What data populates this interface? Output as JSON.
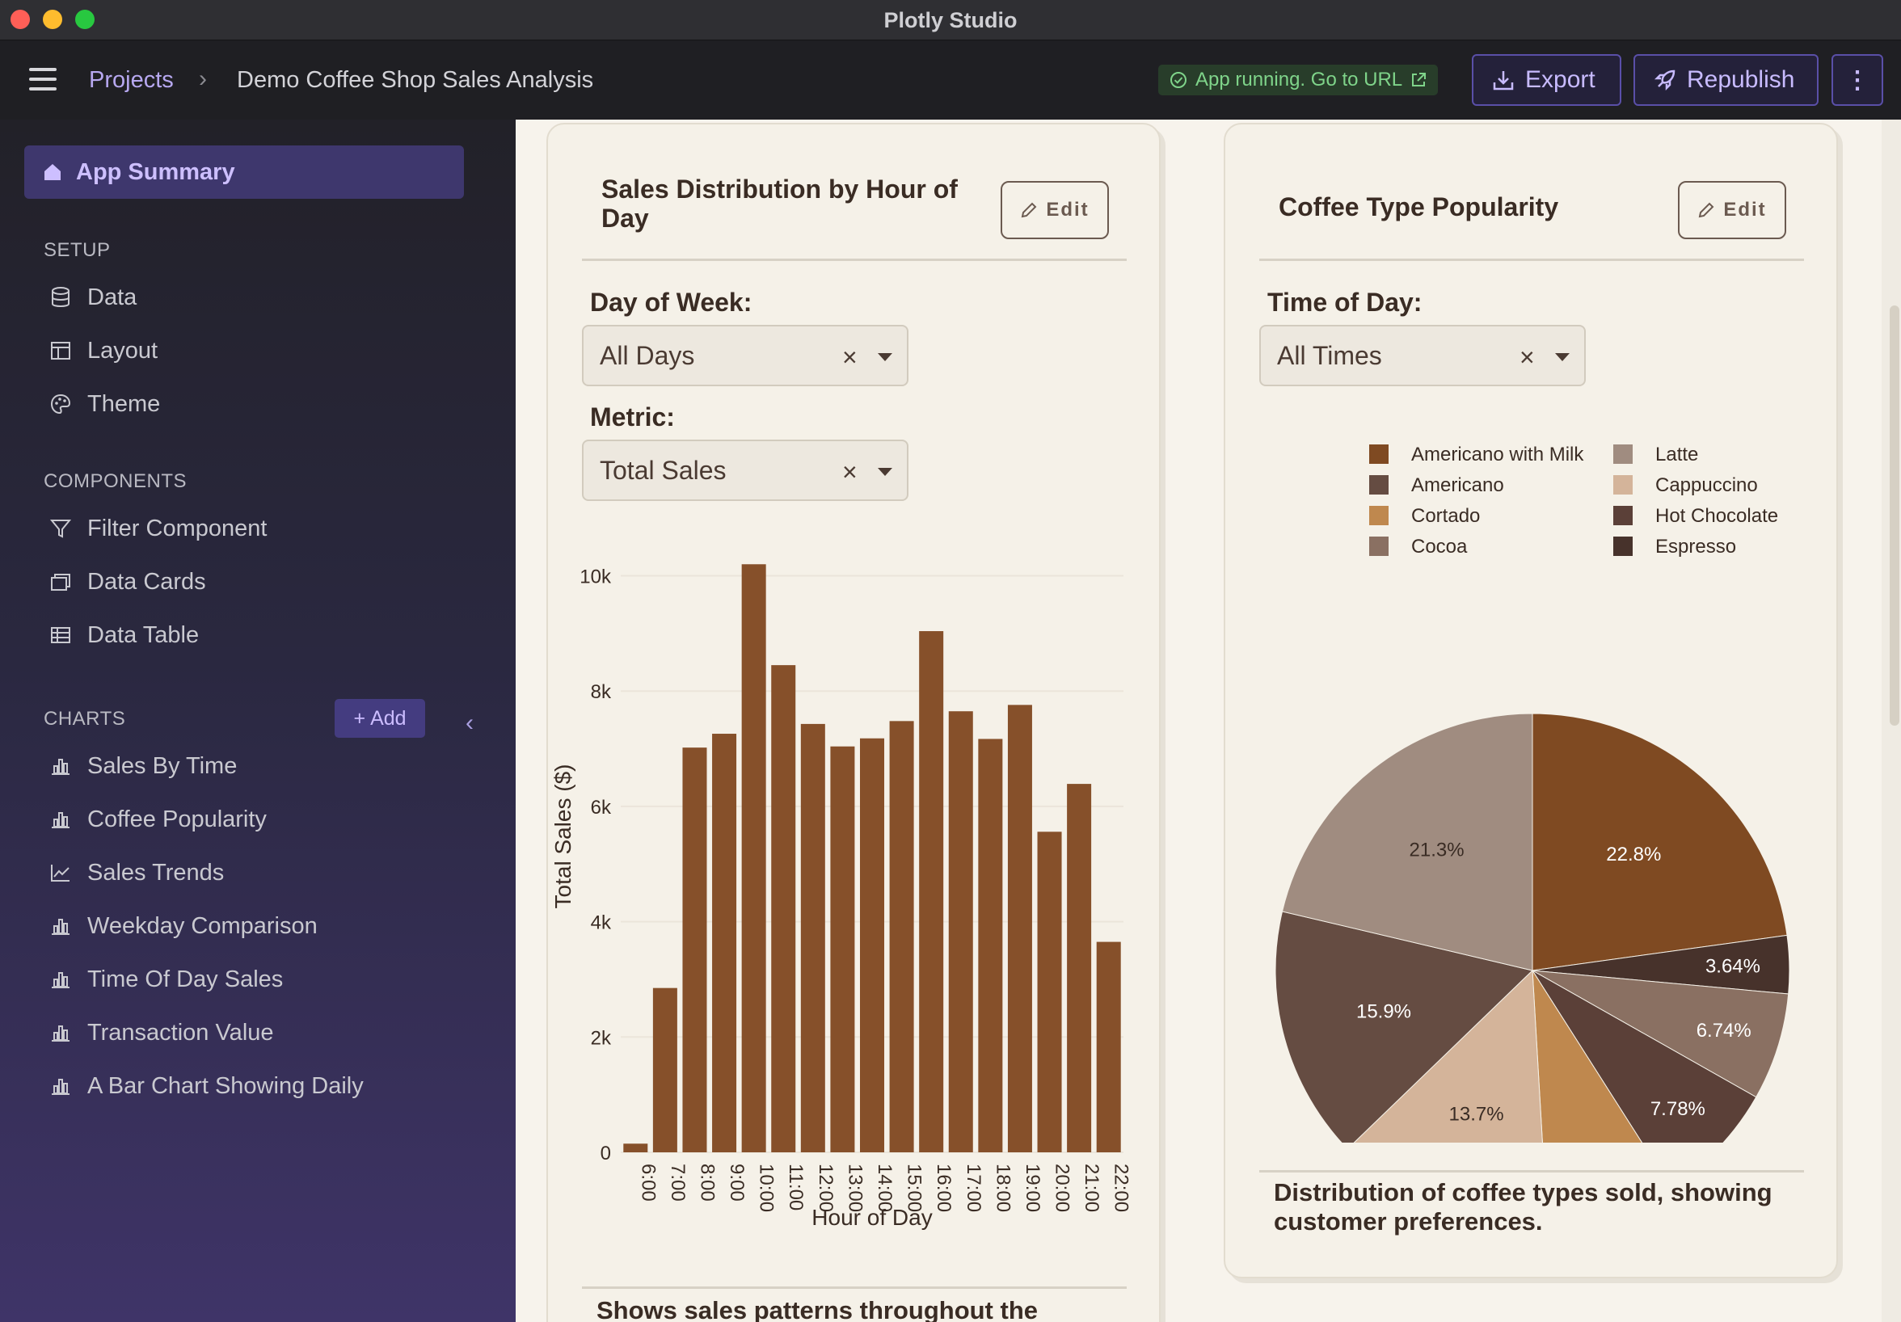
{
  "window": {
    "title": "Plotly Studio"
  },
  "header": {
    "breadcrumb_root": "Projects",
    "breadcrumb_current": "Demo Coffee Shop Sales Analysis",
    "status_text": "App running. Go to URL",
    "export_label": "Export",
    "republish_label": "Republish",
    "more_label": "⋮"
  },
  "sidebar": {
    "app_summary": "App Summary",
    "setup_title": "SETUP",
    "setup_items": [
      "Data",
      "Layout",
      "Theme"
    ],
    "components_title": "COMPONENTS",
    "component_items": [
      "Filter Component",
      "Data Cards",
      "Data Table"
    ],
    "charts_title": "CHARTS",
    "add_label": "Add",
    "chart_items": [
      "Sales By Time",
      "Coffee Popularity",
      "Sales Trends",
      "Weekday Comparison",
      "Time Of Day Sales",
      "Transaction Value",
      "A Bar Chart Showing Daily"
    ]
  },
  "left_card": {
    "title": "Sales Distribution by Hour of Day",
    "edit_label": "Edit",
    "filter1_label": "Day of Week:",
    "filter1_value": "All Days",
    "filter2_label": "Metric:",
    "filter2_value": "Total Sales",
    "caption": "Shows sales patterns throughout the"
  },
  "right_card": {
    "title": "Coffee Type Popularity",
    "edit_label": "Edit",
    "filter_label": "Time of Day:",
    "filter_value": "All Times",
    "caption": "Distribution of coffee types sold, showing customer preferences."
  },
  "colors": {
    "bar": "#86502a",
    "accent": "#5a4fa8"
  },
  "chart_data": [
    {
      "type": "bar",
      "categories": [
        "6:00",
        "7:00",
        "8:00",
        "9:00",
        "10:00",
        "11:00",
        "12:00",
        "13:00",
        "14:00",
        "15:00",
        "16:00",
        "17:00",
        "18:00",
        "19:00",
        "20:00",
        "21:00",
        "22:00"
      ],
      "values": [
        150,
        2850,
        7020,
        7260,
        10200,
        8450,
        7430,
        7040,
        7180,
        7480,
        9040,
        7650,
        7170,
        7760,
        5560,
        6390,
        3650
      ],
      "title": "",
      "xlabel": "Hour of Day",
      "ylabel": "Total Sales ($)",
      "ylim": [
        0,
        10400
      ],
      "yticks": [
        0,
        2000,
        4000,
        6000,
        8000,
        10000
      ],
      "ytick_labels": [
        "0",
        "2k",
        "4k",
        "6k",
        "8k",
        "10k"
      ],
      "grid": true
    },
    {
      "type": "pie",
      "legend_position": "top",
      "slices": [
        {
          "label": "Americano with Milk",
          "value": 22.8,
          "display": "22.8%",
          "color": "#7f4a22"
        },
        {
          "label": "Espresso",
          "value": 3.64,
          "display": "3.64%",
          "color": "#47322b"
        },
        {
          "label": "Cocoa",
          "value": 6.74,
          "display": "6.74%",
          "color": "#8a7062"
        },
        {
          "label": "Hot Chocolate",
          "value": 7.78,
          "display": "7.78%",
          "color": "#5b4038"
        },
        {
          "label": "Cortado",
          "value": 8.09,
          "display": "8.09%",
          "color": "#bf884e"
        },
        {
          "label": "Cappuccino",
          "value": 13.7,
          "display": "13.7%",
          "color": "#d4b49a"
        },
        {
          "label": "Americano",
          "value": 15.9,
          "display": "15.9%",
          "color": "#654c42"
        },
        {
          "label": "Latte",
          "value": 21.3,
          "display": "21.3%",
          "color": "#a08c80"
        }
      ],
      "legend_order": [
        "Americano with Milk",
        "Latte",
        "Americano",
        "Cappuccino",
        "Cortado",
        "Hot Chocolate",
        "Cocoa",
        "Espresso"
      ]
    }
  ]
}
